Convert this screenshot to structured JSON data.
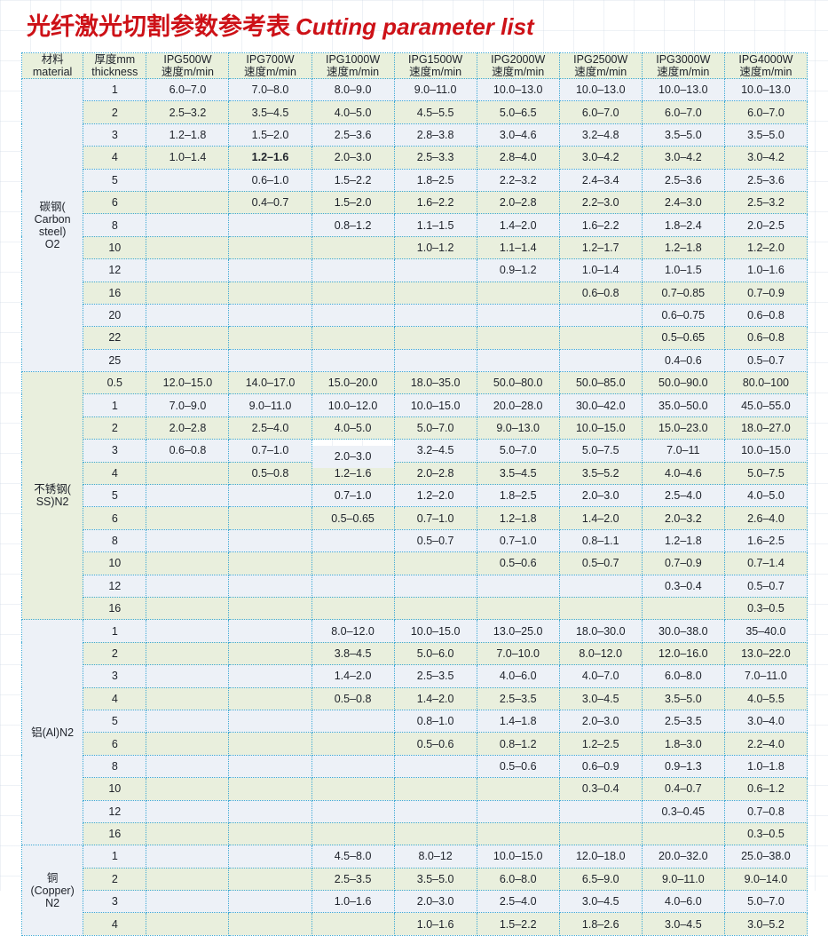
{
  "title": {
    "cn": "光纤激光切割参数参考表",
    "en": "Cutting parameter list"
  },
  "colors": {
    "title_red": "#cd1117",
    "grid_dotted": "#3fa9d4",
    "header_green": "#e9f0dc",
    "stripe_blue": "#edf1f7",
    "stripe_green": "#e9efdd"
  },
  "header": {
    "material": {
      "l1": "材料",
      "l2": "material"
    },
    "thickness": {
      "l1": "厚度mm",
      "l2": "thickness"
    },
    "powers": [
      {
        "l1": "IPG500W",
        "l2": "速度m/min"
      },
      {
        "l1": "IPG700W",
        "l2": "速度m/min"
      },
      {
        "l1": "IPG1000W",
        "l2": "速度m/min"
      },
      {
        "l1": "IPG1500W",
        "l2": "速度m/min"
      },
      {
        "l1": "IPG2000W",
        "l2": "速度m/min"
      },
      {
        "l1": "IPG2500W",
        "l2": "速度m/min"
      },
      {
        "l1": "IPG3000W",
        "l2": "速度m/min"
      },
      {
        "l1": "IPG4000W",
        "l2": "速度m/min"
      }
    ]
  },
  "sections": [
    {
      "id": "carbon-steel",
      "material": "碳钢(\nCarbon\nsteel)\nO2",
      "material_lines": [
        "碳钢(",
        "Carbon",
        "steel)",
        "O2"
      ],
      "material_cell_style": "blue",
      "rows": [
        {
          "thickness": "1",
          "values": [
            "6.0–7.0",
            "7.0–8.0",
            "8.0–9.0",
            "9.0–11.0",
            "10.0–13.0",
            "10.0–13.0",
            "10.0–13.0",
            "10.0–13.0"
          ]
        },
        {
          "thickness": "2",
          "values": [
            "2.5–3.2",
            "3.5–4.5",
            "4.0–5.0",
            "4.5–5.5",
            "5.0–6.5",
            "6.0–7.0",
            "6.0–7.0",
            "6.0–7.0"
          ]
        },
        {
          "thickness": "3",
          "values": [
            "1.2–1.8",
            "1.5–2.0",
            "2.5–3.6",
            "2.8–3.8",
            "3.0–4.6",
            "3.2–4.8",
            "3.5–5.0",
            "3.5–5.0"
          ]
        },
        {
          "thickness": "4",
          "values": [
            "1.0–1.4",
            "1.2–1.6",
            "2.0–3.0",
            "2.5–3.3",
            "2.8–4.0",
            "3.0–4.2",
            "3.0–4.2",
            "3.0–4.2"
          ],
          "bold": [
            1
          ]
        },
        {
          "thickness": "5",
          "values": [
            "",
            "0.6–1.0",
            "1.5–2.2",
            "1.8–2.5",
            "2.2–3.2",
            "2.4–3.4",
            "2.5–3.6",
            "2.5–3.6"
          ]
        },
        {
          "thickness": "6",
          "values": [
            "",
            "0.4–0.7",
            "1.5–2.0",
            "1.6–2.2",
            "2.0–2.8",
            "2.2–3.0",
            "2.4–3.0",
            "2.5–3.2"
          ]
        },
        {
          "thickness": "8",
          "values": [
            "",
            "",
            "0.8–1.2",
            "1.1–1.5",
            "1.4–2.0",
            "1.6–2.2",
            "1.8–2.4",
            "2.0–2.5"
          ]
        },
        {
          "thickness": "10",
          "values": [
            "",
            "",
            "",
            "1.0–1.2",
            "1.1–1.4",
            "1.2–1.7",
            "1.2–1.8",
            "1.2–2.0"
          ]
        },
        {
          "thickness": "12",
          "values": [
            "",
            "",
            "",
            "",
            "0.9–1.2",
            "1.0–1.4",
            "1.0–1.5",
            "1.0–1.6"
          ]
        },
        {
          "thickness": "16",
          "values": [
            "",
            "",
            "",
            "",
            "",
            "0.6–0.8",
            "0.7–0.85",
            "0.7–0.9"
          ]
        },
        {
          "thickness": "20",
          "values": [
            "",
            "",
            "",
            "",
            "",
            "",
            "0.6–0.75",
            "0.6–0.8"
          ]
        },
        {
          "thickness": "22",
          "values": [
            "",
            "",
            "",
            "",
            "",
            "",
            "0.5–0.65",
            "0.6–0.8"
          ]
        },
        {
          "thickness": "25",
          "values": [
            "",
            "",
            "",
            "",
            "",
            "",
            "0.4–0.6",
            "0.5–0.7"
          ]
        }
      ]
    },
    {
      "id": "stainless-steel",
      "material": "不锈钢(\nSS)N2",
      "material_lines": [
        "不锈钢(",
        "SS)N2"
      ],
      "material_cell_style": "green",
      "rows": [
        {
          "thickness": "0.5",
          "values": [
            "12.0–15.0",
            "14.0–17.0",
            "15.0–20.0",
            "18.0–35.0",
            "50.0–80.0",
            "50.0–85.0",
            "50.0–90.0",
            "80.0–100"
          ]
        },
        {
          "thickness": "1",
          "values": [
            "7.0–9.0",
            "9.0–11.0",
            "10.0–12.0",
            "10.0–15.0",
            "20.0–28.0",
            "30.0–42.0",
            "35.0–50.0",
            "45.0–55.0"
          ]
        },
        {
          "thickness": "2",
          "values": [
            "2.0–2.8",
            "2.5–4.0",
            "4.0–5.0",
            "5.0–7.0",
            "9.0–13.0",
            "10.0–15.0",
            "15.0–23.0",
            "18.0–27.0"
          ]
        },
        {
          "thickness": "3",
          "values": [
            "0.6–0.8",
            "0.7–1.0",
            "2.0–3.0",
            "3.2–4.5",
            "5.0–7.0",
            "5.0–7.5",
            "7.0–11",
            "10.0–15.0"
          ],
          "nudge": [
            2
          ]
        },
        {
          "thickness": "4",
          "values": [
            "",
            "0.5–0.8",
            "1.2–1.6",
            "2.0–2.8",
            "3.5–4.5",
            "3.5–5.2",
            "4.0–4.6",
            "5.0–7.5"
          ]
        },
        {
          "thickness": "5",
          "values": [
            "",
            "",
            "0.7–1.0",
            "1.2–2.0",
            "1.8–2.5",
            "2.0–3.0",
            "2.5–4.0",
            "4.0–5.0"
          ]
        },
        {
          "thickness": "6",
          "values": [
            "",
            "",
            "0.5–0.65",
            "0.7–1.0",
            "1.2–1.8",
            "1.4–2.0",
            "2.0–3.2",
            "2.6–4.0"
          ]
        },
        {
          "thickness": "8",
          "values": [
            "",
            "",
            "",
            "0.5–0.7",
            "0.7–1.0",
            "0.8–1.1",
            "1.2–1.8",
            "1.6–2.5"
          ]
        },
        {
          "thickness": "10",
          "values": [
            "",
            "",
            "",
            "",
            "0.5–0.6",
            "0.5–0.7",
            "0.7–0.9",
            "0.7–1.4"
          ]
        },
        {
          "thickness": "12",
          "values": [
            "",
            "",
            "",
            "",
            "",
            "",
            "0.3–0.4",
            "0.5–0.7"
          ]
        },
        {
          "thickness": "16",
          "values": [
            "",
            "",
            "",
            "",
            "",
            "",
            "",
            "0.3–0.5"
          ]
        }
      ]
    },
    {
      "id": "aluminium",
      "material": "铝(Al)N2",
      "material_lines": [
        "铝(Al)N2"
      ],
      "material_cell_style": "blue",
      "rows": [
        {
          "thickness": "1",
          "values": [
            "",
            "",
            "8.0–12.0",
            "10.0–15.0",
            "13.0–25.0",
            "18.0–30.0",
            "30.0–38.0",
            "35–40.0"
          ]
        },
        {
          "thickness": "2",
          "values": [
            "",
            "",
            "3.8–4.5",
            "5.0–6.0",
            "7.0–10.0",
            "8.0–12.0",
            "12.0–16.0",
            "13.0–22.0"
          ]
        },
        {
          "thickness": "3",
          "values": [
            "",
            "",
            "1.4–2.0",
            "2.5–3.5",
            "4.0–6.0",
            "4.0–7.0",
            "6.0–8.0",
            "7.0–11.0"
          ]
        },
        {
          "thickness": "4",
          "values": [
            "",
            "",
            "0.5–0.8",
            "1.4–2.0",
            "2.5–3.5",
            "3.0–4.5",
            "3.5–5.0",
            "4.0–5.5"
          ]
        },
        {
          "thickness": "5",
          "values": [
            "",
            "",
            "",
            "0.8–1.0",
            "1.4–1.8",
            "2.0–3.0",
            "2.5–3.5",
            "3.0–4.0"
          ]
        },
        {
          "thickness": "6",
          "values": [
            "",
            "",
            "",
            "0.5–0.6",
            "0.8–1.2",
            "1.2–2.5",
            "1.8–3.0",
            "2.2–4.0"
          ]
        },
        {
          "thickness": "8",
          "values": [
            "",
            "",
            "",
            "",
            "0.5–0.6",
            "0.6–0.9",
            "0.9–1.3",
            "1.0–1.8"
          ]
        },
        {
          "thickness": "10",
          "values": [
            "",
            "",
            "",
            "",
            "",
            "0.3–0.4",
            "0.4–0.7",
            "0.6–1.2"
          ]
        },
        {
          "thickness": "12",
          "values": [
            "",
            "",
            "",
            "",
            "",
            "",
            "0.3–0.45",
            "0.7–0.8"
          ]
        },
        {
          "thickness": "16",
          "values": [
            "",
            "",
            "",
            "",
            "",
            "",
            "",
            "0.3–0.5"
          ]
        }
      ]
    },
    {
      "id": "copper",
      "material": "铜\n(Copper)\nN2",
      "material_lines": [
        "铜",
        "(Copper)",
        "N2"
      ],
      "material_cell_style": "blue",
      "rows": [
        {
          "thickness": "1",
          "values": [
            "",
            "",
            "4.5–8.0",
            "8.0–12",
            "10.0–15.0",
            "12.0–18.0",
            "20.0–32.0",
            "25.0–38.0"
          ]
        },
        {
          "thickness": "2",
          "values": [
            "",
            "",
            "2.5–3.5",
            "3.5–5.0",
            "6.0–8.0",
            "6.5–9.0",
            "9.0–11.0",
            "9.0–14.0"
          ]
        },
        {
          "thickness": "3",
          "values": [
            "",
            "",
            "1.0–1.6",
            "2.0–3.0",
            "2.5–4.0",
            "3.0–4.5",
            "4.0–6.0",
            "5.0–7.0"
          ]
        },
        {
          "thickness": "4",
          "values": [
            "",
            "",
            "",
            "1.0–1.6",
            "1.5–2.2",
            "1.8–2.6",
            "3.0–4.5",
            "3.0–5.2"
          ]
        }
      ]
    }
  ]
}
